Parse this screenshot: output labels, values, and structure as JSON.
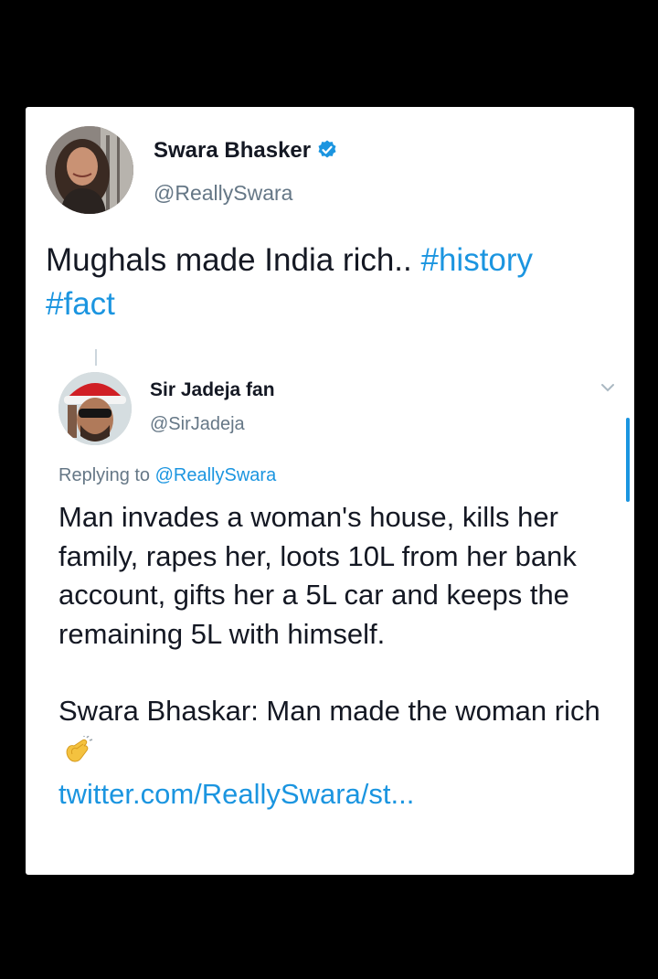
{
  "tweet": {
    "author_name": "Swara Bhasker",
    "author_handle": "@ReallySwara",
    "text": "Mughals made India rich..",
    "hashtag_1": "#history",
    "hashtag_2": "#fact"
  },
  "reply": {
    "author_name": "Sir Jadeja fan",
    "author_handle": "@SirJadeja",
    "replying_prefix": "Replying to",
    "replying_to": "@ReallySwara",
    "paragraph_1": "Man invades a woman's house, kills her family, rapes her, loots 10L from her bank account, gifts her a 5L car and keeps the remaining 5L with himself.",
    "paragraph_2": "Swara Bhaskar: Man made the woman rich",
    "emoji": "clapping-hands",
    "link": "twitter.com/ReallySwara/st..."
  },
  "colors": {
    "background": "#000000",
    "card": "#ffffff",
    "text": "#141823",
    "secondary": "#657786",
    "accent": "#1b95e0"
  }
}
